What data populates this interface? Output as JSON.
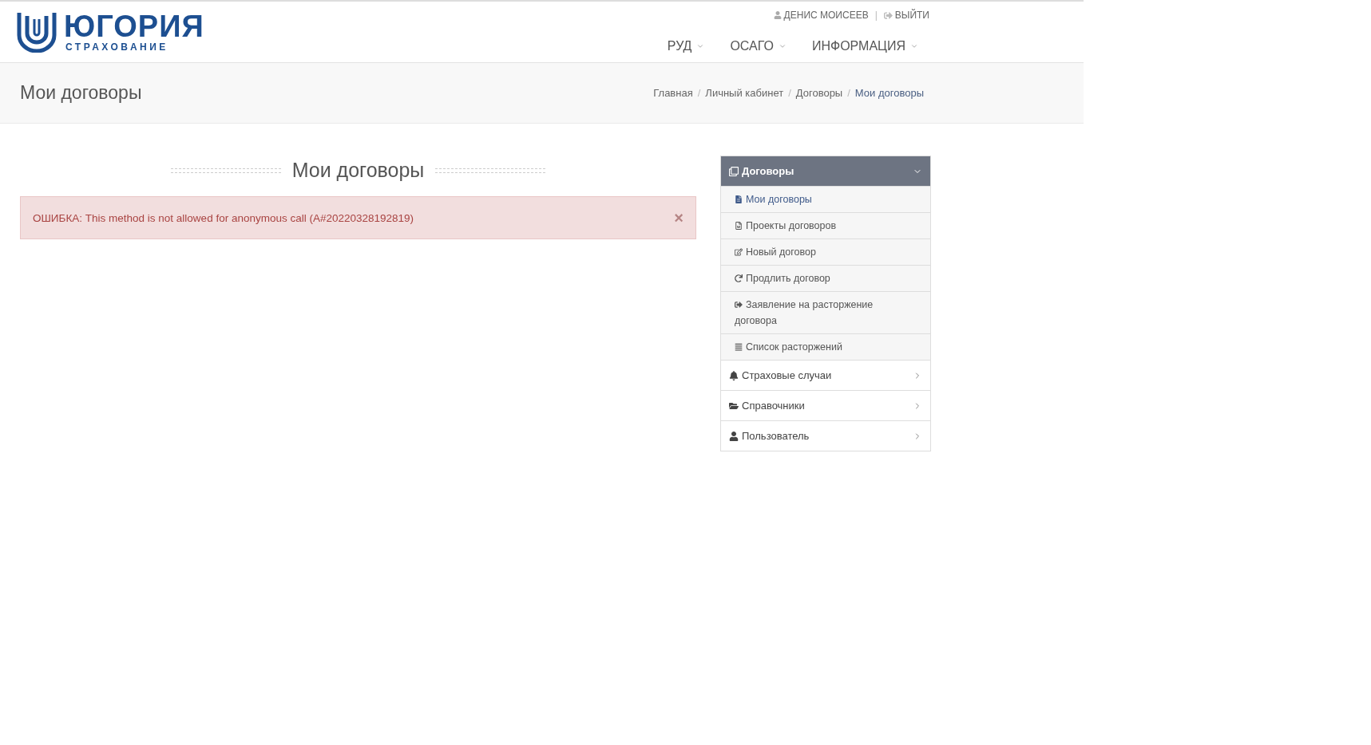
{
  "logo": {
    "name": "ЮГОРИЯ",
    "tagline": "СТРАХОВАНИЕ"
  },
  "user_links": [
    {
      "kind": "user",
      "label": "ДЕНИС МОИСЕЕВ"
    },
    {
      "kind": "logout",
      "label": "ВЫЙТИ"
    }
  ],
  "user_separator": "|",
  "nav": [
    "РУД",
    "ОСАГО",
    "ИНФОРМАЦИЯ"
  ],
  "breadcrumb_separator": "/",
  "page_title": "Мои договоры",
  "breadcrumb": [
    {
      "label": "Главная",
      "current": false
    },
    {
      "label": "Личный кабинет",
      "current": false
    },
    {
      "label": "Договоры",
      "current": false
    },
    {
      "label": "Мои договоры",
      "current": true
    }
  ],
  "heading": "Мои договоры",
  "alert": {
    "text": "ОШИБКА: This method is not allowed for anonymous call (A#20220328192819)",
    "close": "×"
  },
  "sidebar": [
    {
      "label": "Договоры",
      "expanded": true,
      "children": [
        {
          "label": "Мои договоры",
          "selected": true
        },
        {
          "label": "Проекты договоров",
          "selected": false
        },
        {
          "label": "Новый договор",
          "selected": false
        },
        {
          "label": "Продлить договор",
          "selected": false
        },
        {
          "label": "Заявление на расторжение договора",
          "selected": false
        },
        {
          "label": "Список расторжений",
          "selected": false
        }
      ]
    },
    {
      "label": "Страховые случаи",
      "expanded": false
    },
    {
      "label": "Справочники",
      "expanded": false
    },
    {
      "label": "Пользователь",
      "expanded": false
    }
  ]
}
